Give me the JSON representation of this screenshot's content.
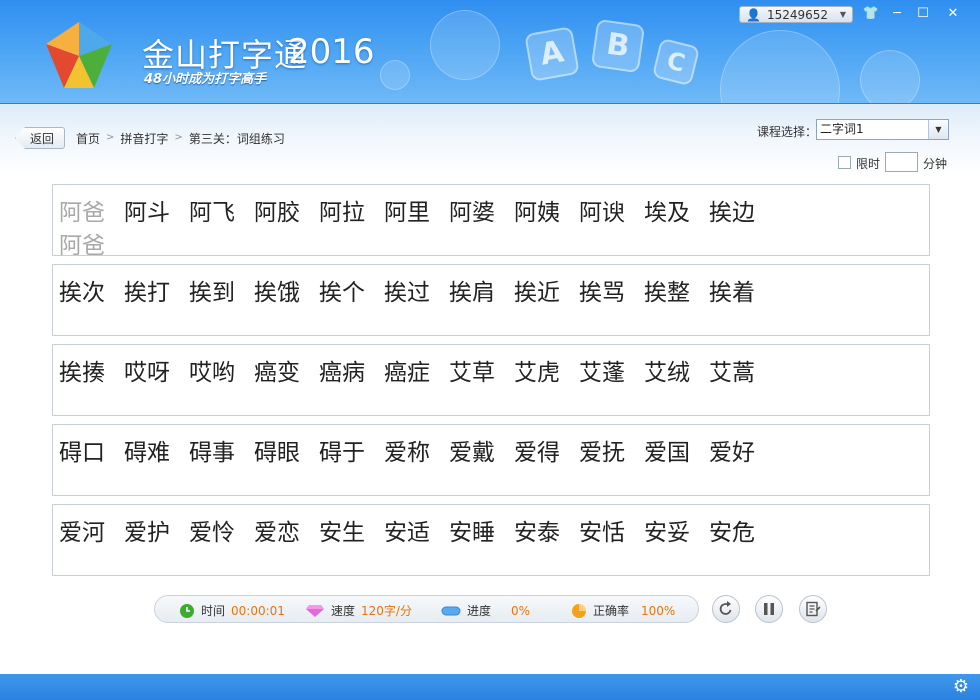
{
  "app": {
    "brand": "金山打字通",
    "year": "2016",
    "slogan": "48小时成为打字高手",
    "blocks": [
      "A",
      "B",
      "C"
    ]
  },
  "user": {
    "id": "15249652"
  },
  "window_controls": {
    "skin": "👕",
    "minimize": "─",
    "maximize": "☐",
    "close": "✕"
  },
  "nav": {
    "back_label": "返回",
    "breadcrumb": [
      "首页",
      "拼音打字",
      "第三关：词组练习"
    ],
    "separator": ">"
  },
  "course": {
    "label": "课程选择：",
    "selected": "二字词1"
  },
  "time_limit": {
    "label": "限时",
    "unit": "分钟",
    "checked": false,
    "value": ""
  },
  "rows": [
    {
      "words": [
        "阿爸",
        "阿斗",
        "阿飞",
        "阿胶",
        "阿拉",
        "阿里",
        "阿婆",
        "阿姨",
        "阿谀",
        "埃及",
        "挨边"
      ],
      "typed": "阿爸",
      "done_count": 1
    },
    {
      "words": [
        "挨次",
        "挨打",
        "挨到",
        "挨饿",
        "挨个",
        "挨过",
        "挨肩",
        "挨近",
        "挨骂",
        "挨整",
        "挨着"
      ],
      "typed": "",
      "done_count": 0
    },
    {
      "words": [
        "挨揍",
        "哎呀",
        "哎哟",
        "癌变",
        "癌病",
        "癌症",
        "艾草",
        "艾虎",
        "艾蓬",
        "艾绒",
        "艾蒿"
      ],
      "typed": "",
      "done_count": 0
    },
    {
      "words": [
        "碍口",
        "碍难",
        "碍事",
        "碍眼",
        "碍于",
        "爱称",
        "爱戴",
        "爱得",
        "爱抚",
        "爱国",
        "爱好"
      ],
      "typed": "",
      "done_count": 0
    },
    {
      "words": [
        "爱河",
        "爱护",
        "爱怜",
        "爱恋",
        "安生",
        "安适",
        "安睡",
        "安泰",
        "安恬",
        "安妥",
        "安危"
      ],
      "typed": "",
      "done_count": 0
    }
  ],
  "stats": {
    "time": {
      "label": "时间",
      "value": "00:00:01"
    },
    "speed": {
      "label": "速度",
      "value": "120字/分"
    },
    "progress": {
      "label": "进度",
      "value": "0%"
    },
    "accuracy": {
      "label": "正确率",
      "value": "100%"
    }
  },
  "colors": {
    "header": "#3b97f0",
    "stat_value": "#e8740c",
    "footer": "#2b82e0"
  }
}
